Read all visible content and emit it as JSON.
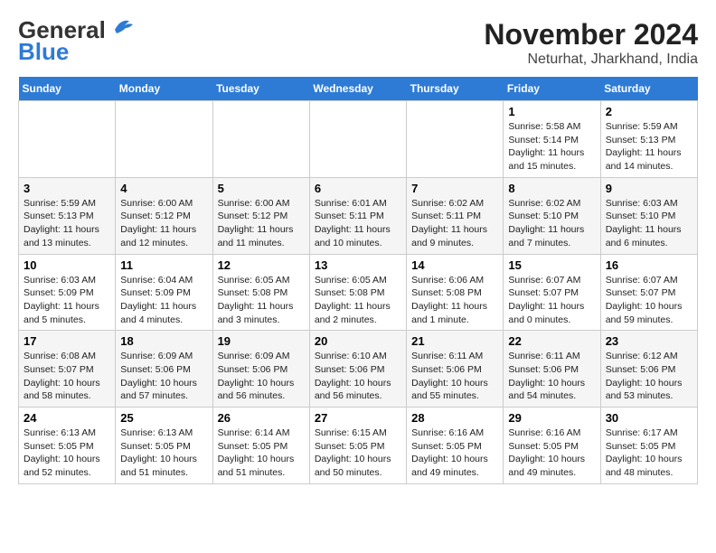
{
  "header": {
    "logo_general": "General",
    "logo_blue": "Blue",
    "title": "November 2024",
    "subtitle": "Neturhat, Jharkhand, India"
  },
  "days_of_week": [
    "Sunday",
    "Monday",
    "Tuesday",
    "Wednesday",
    "Thursday",
    "Friday",
    "Saturday"
  ],
  "weeks": [
    [
      {
        "day": "",
        "info": ""
      },
      {
        "day": "",
        "info": ""
      },
      {
        "day": "",
        "info": ""
      },
      {
        "day": "",
        "info": ""
      },
      {
        "day": "",
        "info": ""
      },
      {
        "day": "1",
        "info": "Sunrise: 5:58 AM\nSunset: 5:14 PM\nDaylight: 11 hours and 15 minutes."
      },
      {
        "day": "2",
        "info": "Sunrise: 5:59 AM\nSunset: 5:13 PM\nDaylight: 11 hours and 14 minutes."
      }
    ],
    [
      {
        "day": "3",
        "info": "Sunrise: 5:59 AM\nSunset: 5:13 PM\nDaylight: 11 hours and 13 minutes."
      },
      {
        "day": "4",
        "info": "Sunrise: 6:00 AM\nSunset: 5:12 PM\nDaylight: 11 hours and 12 minutes."
      },
      {
        "day": "5",
        "info": "Sunrise: 6:00 AM\nSunset: 5:12 PM\nDaylight: 11 hours and 11 minutes."
      },
      {
        "day": "6",
        "info": "Sunrise: 6:01 AM\nSunset: 5:11 PM\nDaylight: 11 hours and 10 minutes."
      },
      {
        "day": "7",
        "info": "Sunrise: 6:02 AM\nSunset: 5:11 PM\nDaylight: 11 hours and 9 minutes."
      },
      {
        "day": "8",
        "info": "Sunrise: 6:02 AM\nSunset: 5:10 PM\nDaylight: 11 hours and 7 minutes."
      },
      {
        "day": "9",
        "info": "Sunrise: 6:03 AM\nSunset: 5:10 PM\nDaylight: 11 hours and 6 minutes."
      }
    ],
    [
      {
        "day": "10",
        "info": "Sunrise: 6:03 AM\nSunset: 5:09 PM\nDaylight: 11 hours and 5 minutes."
      },
      {
        "day": "11",
        "info": "Sunrise: 6:04 AM\nSunset: 5:09 PM\nDaylight: 11 hours and 4 minutes."
      },
      {
        "day": "12",
        "info": "Sunrise: 6:05 AM\nSunset: 5:08 PM\nDaylight: 11 hours and 3 minutes."
      },
      {
        "day": "13",
        "info": "Sunrise: 6:05 AM\nSunset: 5:08 PM\nDaylight: 11 hours and 2 minutes."
      },
      {
        "day": "14",
        "info": "Sunrise: 6:06 AM\nSunset: 5:08 PM\nDaylight: 11 hours and 1 minute."
      },
      {
        "day": "15",
        "info": "Sunrise: 6:07 AM\nSunset: 5:07 PM\nDaylight: 11 hours and 0 minutes."
      },
      {
        "day": "16",
        "info": "Sunrise: 6:07 AM\nSunset: 5:07 PM\nDaylight: 10 hours and 59 minutes."
      }
    ],
    [
      {
        "day": "17",
        "info": "Sunrise: 6:08 AM\nSunset: 5:07 PM\nDaylight: 10 hours and 58 minutes."
      },
      {
        "day": "18",
        "info": "Sunrise: 6:09 AM\nSunset: 5:06 PM\nDaylight: 10 hours and 57 minutes."
      },
      {
        "day": "19",
        "info": "Sunrise: 6:09 AM\nSunset: 5:06 PM\nDaylight: 10 hours and 56 minutes."
      },
      {
        "day": "20",
        "info": "Sunrise: 6:10 AM\nSunset: 5:06 PM\nDaylight: 10 hours and 56 minutes."
      },
      {
        "day": "21",
        "info": "Sunrise: 6:11 AM\nSunset: 5:06 PM\nDaylight: 10 hours and 55 minutes."
      },
      {
        "day": "22",
        "info": "Sunrise: 6:11 AM\nSunset: 5:06 PM\nDaylight: 10 hours and 54 minutes."
      },
      {
        "day": "23",
        "info": "Sunrise: 6:12 AM\nSunset: 5:06 PM\nDaylight: 10 hours and 53 minutes."
      }
    ],
    [
      {
        "day": "24",
        "info": "Sunrise: 6:13 AM\nSunset: 5:05 PM\nDaylight: 10 hours and 52 minutes."
      },
      {
        "day": "25",
        "info": "Sunrise: 6:13 AM\nSunset: 5:05 PM\nDaylight: 10 hours and 51 minutes."
      },
      {
        "day": "26",
        "info": "Sunrise: 6:14 AM\nSunset: 5:05 PM\nDaylight: 10 hours and 51 minutes."
      },
      {
        "day": "27",
        "info": "Sunrise: 6:15 AM\nSunset: 5:05 PM\nDaylight: 10 hours and 50 minutes."
      },
      {
        "day": "28",
        "info": "Sunrise: 6:16 AM\nSunset: 5:05 PM\nDaylight: 10 hours and 49 minutes."
      },
      {
        "day": "29",
        "info": "Sunrise: 6:16 AM\nSunset: 5:05 PM\nDaylight: 10 hours and 49 minutes."
      },
      {
        "day": "30",
        "info": "Sunrise: 6:17 AM\nSunset: 5:05 PM\nDaylight: 10 hours and 48 minutes."
      }
    ]
  ]
}
